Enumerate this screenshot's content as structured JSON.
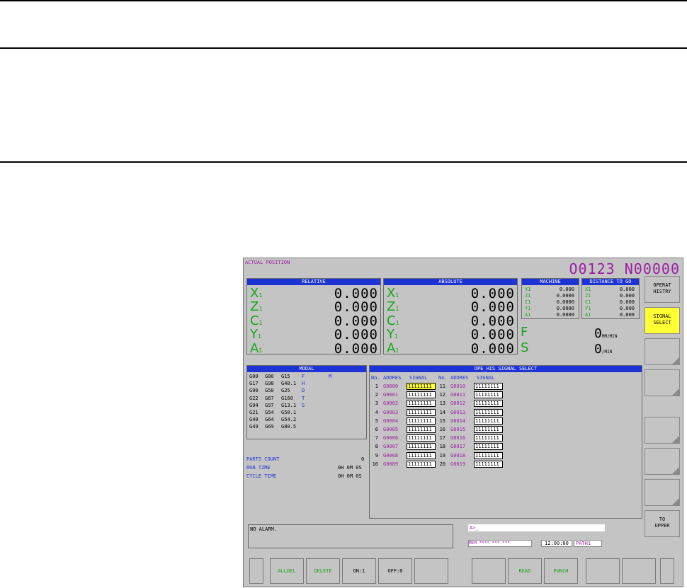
{
  "screen": {
    "title": "ACTUAL POSITION",
    "program": "O0123 N00000"
  },
  "relative": {
    "header": "RELATIVE",
    "axes": [
      {
        "name": "X",
        "sub": "1",
        "value": "0.000"
      },
      {
        "name": "Z",
        "sub": "1",
        "value": "0.000"
      },
      {
        "name": "C",
        "sub": "1",
        "value": "0.000"
      },
      {
        "name": "Y",
        "sub": "1",
        "value": "0.000"
      },
      {
        "name": "A",
        "sub": "1",
        "value": "0.000"
      }
    ]
  },
  "absolute": {
    "header": "ABSOLUTE",
    "axes": [
      {
        "name": "X",
        "sub": "1",
        "value": "0.000"
      },
      {
        "name": "Z",
        "sub": "1",
        "value": "0.000"
      },
      {
        "name": "C",
        "sub": "1",
        "value": "0.000"
      },
      {
        "name": "Y",
        "sub": "1",
        "value": "0.000"
      },
      {
        "name": "A",
        "sub": "1",
        "value": "0.000"
      }
    ]
  },
  "machine": {
    "header": "MACHINE",
    "rows": [
      {
        "name": "X1",
        "value": "0.000"
      },
      {
        "name": "Z1",
        "value": "0.0000"
      },
      {
        "name": "C1",
        "value": "0.0000"
      },
      {
        "name": "Y1",
        "value": "0.0000"
      },
      {
        "name": "A1",
        "value": "0.0000"
      }
    ]
  },
  "distance_to_go": {
    "header": "DISTANCE TO GO",
    "rows": [
      {
        "name": "X1",
        "value": "0.000"
      },
      {
        "name": "Z1",
        "value": "0.000"
      },
      {
        "name": "C1",
        "value": "0.000"
      },
      {
        "name": "Y1",
        "value": "0.000"
      },
      {
        "name": "A1",
        "value": "0.000"
      }
    ]
  },
  "feed": {
    "letter": "F",
    "value": "0",
    "unit": "MM/MIN"
  },
  "spindle": {
    "letter": "S",
    "value": "0",
    "unit": "/MIN"
  },
  "modal": {
    "header": "MODAL",
    "rows": [
      [
        "G00",
        "G80",
        "G15",
        "F",
        "M"
      ],
      [
        "G17",
        "G98",
        "G40.1",
        "H",
        ""
      ],
      [
        "G90",
        "G50",
        "G25",
        "D",
        ""
      ],
      [
        "G22",
        "G67",
        "G160",
        "T",
        ""
      ],
      [
        "G94",
        "G97",
        "G13.1",
        "S",
        ""
      ],
      [
        "G21",
        "G54",
        "G50.1",
        "",
        ""
      ],
      [
        "G40",
        "G64",
        "G54.2",
        "",
        ""
      ],
      [
        "G49",
        "G69",
        "G80.5",
        "",
        ""
      ]
    ]
  },
  "info": {
    "parts_count_label": "PARTS COUNT",
    "parts_count": "0",
    "run_time_label": "RUN TIME",
    "run_time": "0H 0M 0S",
    "cycle_time_label": "CYCLE TIME",
    "cycle_time": "0H 0M 0S"
  },
  "signal_select": {
    "header": "OPE_HIS SIGNAL SELECT",
    "col_no": "No.",
    "col_address": "ADDRES",
    "col_signal": "SIGNAL",
    "left": [
      {
        "no": "1",
        "address": "G0000",
        "signal": "11111111"
      },
      {
        "no": "2",
        "address": "G0001",
        "signal": "11111111"
      },
      {
        "no": "3",
        "address": "G0002",
        "signal": "11111111"
      },
      {
        "no": "4",
        "address": "G0003",
        "signal": "11111111"
      },
      {
        "no": "5",
        "address": "G0004",
        "signal": "11111111"
      },
      {
        "no": "6",
        "address": "G0005",
        "signal": "11111111"
      },
      {
        "no": "7",
        "address": "G0006",
        "signal": "11111111"
      },
      {
        "no": "8",
        "address": "G0007",
        "signal": "11111111"
      },
      {
        "no": "9",
        "address": "G0008",
        "signal": "11111111"
      },
      {
        "no": "10",
        "address": "G0009",
        "signal": "11111111"
      }
    ],
    "right": [
      {
        "no": "11",
        "address": "G0010",
        "signal": "11111111"
      },
      {
        "no": "12",
        "address": "G0011",
        "signal": "11111111"
      },
      {
        "no": "13",
        "address": "G0012",
        "signal": "11111111"
      },
      {
        "no": "14",
        "address": "G0013",
        "signal": "11111111"
      },
      {
        "no": "15",
        "address": "G0014",
        "signal": "11111111"
      },
      {
        "no": "16",
        "address": "G0015",
        "signal": "11111111"
      },
      {
        "no": "17",
        "address": "G0016",
        "signal": "11111111"
      },
      {
        "no": "18",
        "address": "G0017",
        "signal": "11111111"
      },
      {
        "no": "19",
        "address": "G0018",
        "signal": "11111111"
      },
      {
        "no": "20",
        "address": "G0019",
        "signal": "11111111"
      }
    ]
  },
  "alarm": "NO ALARM.",
  "input_prompt": "A>_",
  "status": {
    "mode": "MEM",
    "stars": "**** *** ***",
    "time": "12:00:00",
    "path": "PATH1"
  },
  "side_keys": [
    {
      "label": "OPERAT\nHISTRY",
      "active": false
    },
    {
      "label": "SIGNAL\nSELECT",
      "active": true
    },
    {
      "label": "",
      "active": false
    },
    {
      "label": "",
      "active": false
    },
    {
      "label": "",
      "active": false
    },
    {
      "label": "",
      "active": false
    },
    {
      "label": "",
      "active": false
    },
    {
      "label": "TO\nUPPER",
      "active": false
    }
  ],
  "bottom_keys": [
    "",
    "ALLDEL",
    "DELETE",
    "ON:1",
    "OFF:0",
    "",
    "",
    "READ",
    "PUNCH",
    "",
    "",
    ""
  ],
  "colors": {
    "header_blue": "#1e33d6",
    "axis_green": "#17a617",
    "program_magenta": "#9b1fa3",
    "select_yellow": "#ffff33"
  }
}
